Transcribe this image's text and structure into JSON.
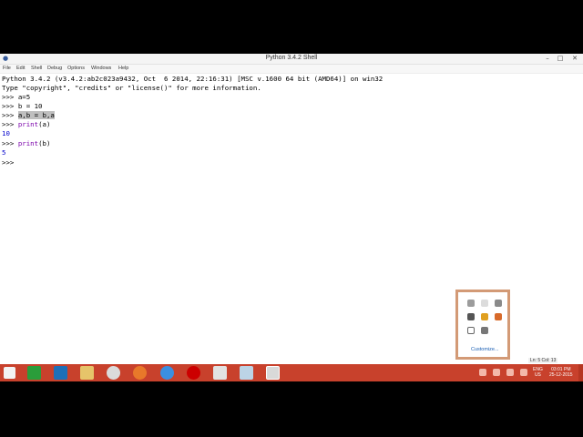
{
  "window": {
    "title": "Python 3.4.2 Shell"
  },
  "menu": [
    "File",
    "Edit",
    "Shell",
    "Debug",
    "Options",
    "Windows",
    "Help"
  ],
  "shell": {
    "banner1": "Python 3.4.2 (v3.4.2:ab2c023a9432, Oct  6 2014, 22:16:31) [MSC v.1600 64 bit (AMD64)] on win32",
    "banner2": "Type \"copyright\", \"credits\" or \"license()\" for more information.",
    "prompt": ">>> ",
    "cmd1": "a=5",
    "cmd2": "b = 10",
    "cmd3": "a,b = b,a",
    "cmd4_kw": "print",
    "cmd4_arg": "(a)",
    "out1": "10",
    "cmd5_kw": "print",
    "cmd5_arg": "(b)",
    "out2": "5",
    "last_prompt": ">>> "
  },
  "status": {
    "text": "Ln: 5 Col: 13"
  },
  "tray": {
    "customize_label": "Customize..."
  },
  "taskbar": {
    "lang": "ENG",
    "region": "US",
    "time": "03:01 PM",
    "date": "25-12-2015"
  }
}
